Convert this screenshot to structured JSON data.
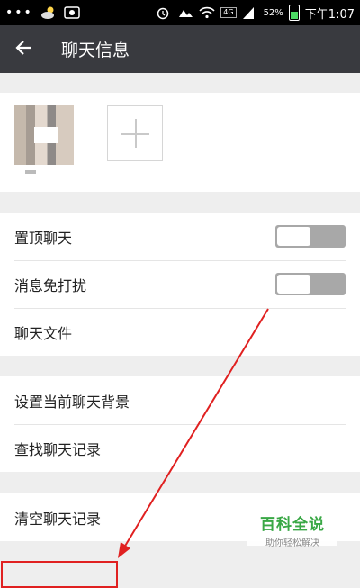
{
  "status_bar": {
    "dots": "•••",
    "network": "4G",
    "battery": "52%",
    "time": "下午1:07"
  },
  "app_bar": {
    "title": "聊天信息",
    "back_icon": "arrow-left-icon"
  },
  "settings": {
    "group1": [
      {
        "label": "置顶聊天",
        "toggle": false
      },
      {
        "label": "消息免打扰",
        "toggle": false
      },
      {
        "label": "聊天文件"
      }
    ],
    "group2": [
      {
        "label": "设置当前聊天背景"
      },
      {
        "label": "查找聊天记录"
      }
    ],
    "group3": [
      {
        "label": "清空聊天记录"
      }
    ]
  },
  "watermark": {
    "title": "百科全说",
    "subtitle": "助你轻松解决"
  },
  "colors": {
    "app_bar": "#393a3f",
    "annotation": "#e02020",
    "watermark_green": "#3aa846"
  }
}
